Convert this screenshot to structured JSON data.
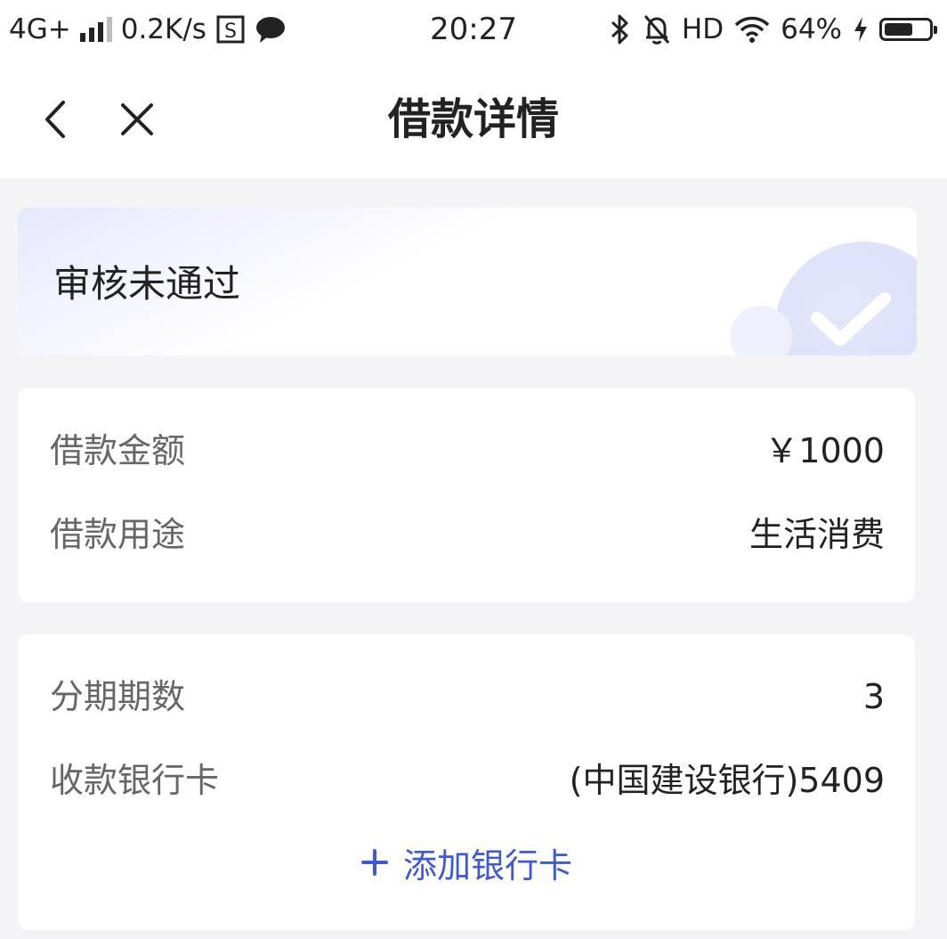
{
  "status_bar": {
    "network": "4G+",
    "speed": "0.2K/s",
    "time": "20:27",
    "hd": "HD",
    "battery": "64%",
    "battery_level": 0.64
  },
  "nav": {
    "title": "借款详情"
  },
  "status_card": {
    "text": "审核未通过"
  },
  "loan_info": {
    "amount_label": "借款金额",
    "amount_value": "￥1000",
    "purpose_label": "借款用途",
    "purpose_value": "生活消费"
  },
  "repay_info": {
    "installments_label": "分期期数",
    "installments_value": "3",
    "bank_label": "收款银行卡",
    "bank_value": "(中国建设银行)5409",
    "add_card_label": "添加银行卡"
  },
  "colors": {
    "accent": "#3e59d6",
    "background": "#f4f4f6"
  }
}
